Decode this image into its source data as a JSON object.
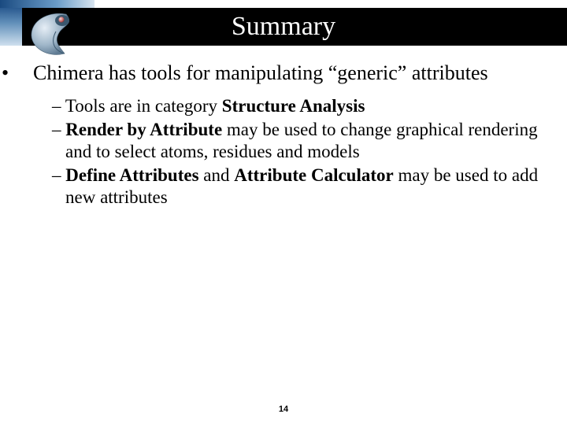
{
  "title": "Summary",
  "bullets": [
    {
      "text_a": "Chimera has tools for manipulating “generic” attributes",
      "subs": [
        {
          "pre": "Tools are in category ",
          "b1": "Structure Analysis",
          "mid": "",
          "b2": "",
          "post": ""
        },
        {
          "pre": "",
          "b1": "Render by Attribute",
          "mid": " may be used to change graphical rendering and to select atoms, residues and models",
          "b2": "",
          "post": ""
        },
        {
          "pre": "",
          "b1": "Define Attributes",
          "mid": " and ",
          "b2": "Attribute Calculator",
          "post": " may be used to add new attributes"
        }
      ]
    }
  ],
  "page_number": "14"
}
